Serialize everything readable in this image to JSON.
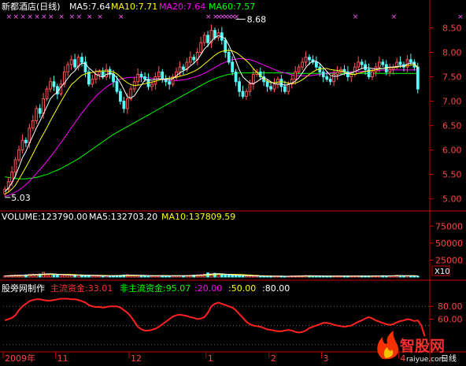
{
  "header": {
    "stock": "新都酒店(日线)",
    "ma5": "MA5:7.64",
    "ma10": "MA10:7.71",
    "ma20": "MA20:7.64",
    "ma60": "MA60:7.57"
  },
  "volume_header": {
    "volume": "VOLUME:123790.00",
    "ma5": "MA5:132703.20",
    "ma10": "MA10:137809.59",
    "multiplier": "X10"
  },
  "indicator_header": {
    "name": "股旁网制作",
    "main_fund": "主流资金:33.01",
    "non_main_fund": "非主流资金:95.07",
    "v20": ":20.00",
    "v50": ":50.00",
    "v80": ":80.00"
  },
  "x_axis": {
    "labels": [
      {
        "text": "2009年",
        "i": 0
      },
      {
        "text": "11",
        "i": 15
      },
      {
        "text": "12",
        "i": 36
      },
      {
        "text": "1",
        "i": 58
      },
      {
        "text": "2",
        "i": 76
      },
      {
        "text": "3",
        "i": 91
      },
      {
        "text": "4",
        "i": 113
      }
    ],
    "period": "日线"
  },
  "watermark": {
    "text": "智股网",
    "url": "raiyue.com"
  },
  "colors": {
    "up": "#ff5555",
    "down": "#55ffff",
    "ma5": "#ffffff",
    "ma10": "#ffff00",
    "ma20": "#ff00ff",
    "ma60": "#00ff00",
    "indicator": "#ff2020",
    "axis": "#cc0000",
    "text": "#ff4444"
  },
  "chart_data": [
    {
      "type": "candlestick",
      "title": "新都酒店(日线)",
      "ylim": [
        4.85,
        8.75
      ],
      "yticks": [
        5.0,
        5.5,
        6.0,
        6.5,
        7.0,
        7.5,
        8.0,
        8.5
      ],
      "annotations": [
        {
          "text": "8.68",
          "i": 66,
          "value": 8.68,
          "label": "high"
        },
        {
          "text": "5.03",
          "i": 0,
          "value": 5.03,
          "label": "low"
        }
      ],
      "markers": {
        "symbol": "×",
        "indices": [
          1,
          3,
          5,
          7,
          9,
          11,
          13,
          16,
          19,
          21,
          24,
          27,
          33,
          58,
          60,
          61,
          62,
          63,
          64,
          65,
          66,
          100,
          111,
          130
        ]
      },
      "close": [
        5.2,
        5.35,
        5.55,
        5.8,
        6.0,
        6.2,
        6.15,
        6.45,
        6.6,
        6.85,
        6.75,
        7.05,
        7.25,
        7.4,
        7.3,
        7.15,
        7.35,
        7.6,
        7.75,
        7.85,
        7.7,
        7.9,
        7.8,
        7.6,
        7.35,
        7.45,
        7.55,
        7.6,
        7.5,
        7.65,
        7.55,
        7.4,
        7.2,
        7.0,
        6.85,
        7.05,
        7.25,
        7.4,
        7.55,
        7.5,
        7.45,
        7.3,
        7.35,
        7.5,
        7.6,
        7.45,
        7.4,
        7.35,
        7.5,
        7.6,
        7.7,
        7.65,
        7.8,
        7.9,
        7.85,
        8.0,
        8.2,
        8.35,
        8.2,
        8.45,
        8.3,
        8.4,
        8.25,
        8.0,
        7.8,
        7.6,
        7.4,
        7.2,
        7.1,
        7.2,
        7.35,
        7.55,
        7.6,
        7.5,
        7.4,
        7.3,
        7.25,
        7.35,
        7.45,
        7.3,
        7.2,
        7.35,
        7.45,
        7.6,
        7.7,
        7.8,
        7.9,
        7.85,
        7.8,
        7.7,
        7.6,
        7.5,
        7.45,
        7.4,
        7.55,
        7.6,
        7.65,
        7.6,
        7.5,
        7.55,
        7.7,
        7.8,
        7.75,
        7.65,
        7.5,
        7.6,
        7.7,
        7.8,
        7.75,
        7.6,
        7.65,
        7.7,
        7.8,
        7.75,
        7.7,
        7.85,
        7.8,
        7.7,
        7.25
      ],
      "ma5": [
        5.15,
        5.22,
        5.33,
        5.47,
        5.65,
        5.84,
        5.97,
        6.14,
        6.29,
        6.45,
        6.59,
        6.74,
        6.89,
        7.05,
        7.13,
        7.18,
        7.29,
        7.37,
        7.47,
        7.56,
        7.62,
        7.72,
        7.78,
        7.77,
        7.68,
        7.62,
        7.55,
        7.52,
        7.49,
        7.55,
        7.57,
        7.56,
        7.48,
        7.38,
        7.24,
        7.09,
        7.07,
        7.11,
        7.22,
        7.33,
        7.43,
        7.44,
        7.43,
        7.45,
        7.46,
        7.45,
        7.46,
        7.44,
        7.46,
        7.52,
        7.58,
        7.62,
        7.66,
        7.72,
        7.78,
        7.85,
        7.95,
        8.07,
        8.14,
        8.23,
        8.3,
        8.34,
        8.32,
        8.28,
        8.15,
        7.99,
        7.83,
        7.64,
        7.5,
        7.43,
        7.37,
        7.36,
        7.4,
        7.45,
        7.48,
        7.45,
        7.4,
        7.36,
        7.35,
        7.35,
        7.33,
        7.34,
        7.37,
        7.41,
        7.48,
        7.58,
        7.69,
        7.77,
        7.82,
        7.82,
        7.77,
        7.69,
        7.61,
        7.53,
        7.51,
        7.51,
        7.54,
        7.56,
        7.57,
        7.58,
        7.61,
        7.64,
        7.67,
        7.69,
        7.68,
        7.67,
        7.66,
        7.67,
        7.67,
        7.69,
        7.7,
        7.7,
        7.71,
        7.72,
        7.72,
        7.76,
        7.78,
        7.78,
        7.66
      ],
      "ma10": [
        5.1,
        5.14,
        5.2,
        5.28,
        5.4,
        5.52,
        5.65,
        5.78,
        5.92,
        6.06,
        6.2,
        6.33,
        6.46,
        6.6,
        6.73,
        6.86,
        6.99,
        7.11,
        7.23,
        7.34,
        7.4,
        7.47,
        7.53,
        7.56,
        7.58,
        7.59,
        7.61,
        7.62,
        7.62,
        7.62,
        7.61,
        7.6,
        7.56,
        7.5,
        7.43,
        7.38,
        7.34,
        7.32,
        7.33,
        7.34,
        7.36,
        7.38,
        7.39,
        7.41,
        7.43,
        7.45,
        7.46,
        7.47,
        7.48,
        7.49,
        7.51,
        7.53,
        7.55,
        7.58,
        7.61,
        7.65,
        7.7,
        7.76,
        7.82,
        7.88,
        7.94,
        7.99,
        8.02,
        8.04,
        8.04,
        8.03,
        8.0,
        7.95,
        7.89,
        7.83,
        7.76,
        7.67,
        7.59,
        7.52,
        7.46,
        7.41,
        7.38,
        7.38,
        7.39,
        7.4,
        7.39,
        7.37,
        7.36,
        7.37,
        7.4,
        7.44,
        7.49,
        7.55,
        7.6,
        7.64,
        7.66,
        7.67,
        7.67,
        7.65,
        7.64,
        7.63,
        7.62,
        7.6,
        7.57,
        7.55,
        7.55,
        7.57,
        7.59,
        7.61,
        7.62,
        7.63,
        7.64,
        7.66,
        7.67,
        7.68,
        7.69,
        7.69,
        7.7,
        7.71,
        7.72,
        7.73,
        7.74,
        7.75,
        7.71
      ],
      "ma20": [
        5.05,
        5.07,
        5.1,
        5.14,
        5.18,
        5.23,
        5.29,
        5.36,
        5.44,
        5.52,
        5.6,
        5.68,
        5.77,
        5.86,
        5.95,
        6.05,
        6.15,
        6.25,
        6.35,
        6.46,
        6.56,
        6.66,
        6.76,
        6.85,
        6.94,
        7.02,
        7.1,
        7.17,
        7.23,
        7.29,
        7.34,
        7.38,
        7.42,
        7.45,
        7.47,
        7.48,
        7.49,
        7.49,
        7.49,
        7.49,
        7.49,
        7.48,
        7.47,
        7.46,
        7.45,
        7.44,
        7.43,
        7.42,
        7.42,
        7.42,
        7.43,
        7.44,
        7.45,
        7.47,
        7.49,
        7.51,
        7.54,
        7.57,
        7.61,
        7.65,
        7.69,
        7.73,
        7.77,
        7.8,
        7.83,
        7.85,
        7.86,
        7.87,
        7.87,
        7.86,
        7.85,
        7.83,
        7.8,
        7.77,
        7.74,
        7.71,
        7.68,
        7.65,
        7.62,
        7.6,
        7.58,
        7.56,
        7.54,
        7.53,
        7.52,
        7.52,
        7.52,
        7.52,
        7.53,
        7.54,
        7.55,
        7.56,
        7.57,
        7.58,
        7.59,
        7.6,
        7.6,
        7.6,
        7.6,
        7.6,
        7.6,
        7.61,
        7.61,
        7.62,
        7.62,
        7.63,
        7.63,
        7.63,
        7.64,
        7.64,
        7.64,
        7.64,
        7.64,
        7.64,
        7.64,
        7.64,
        7.64,
        7.64,
        7.64
      ],
      "ma60": [
        5.45,
        5.44,
        5.43,
        5.42,
        5.41,
        5.41,
        5.41,
        5.42,
        5.43,
        5.44,
        5.46,
        5.48,
        5.5,
        5.53,
        5.56,
        5.59,
        5.62,
        5.66,
        5.7,
        5.74,
        5.78,
        5.82,
        5.87,
        5.92,
        5.97,
        6.02,
        6.07,
        6.12,
        6.17,
        6.22,
        6.27,
        6.32,
        6.36,
        6.4,
        6.44,
        6.48,
        6.52,
        6.56,
        6.6,
        6.64,
        6.68,
        6.72,
        6.76,
        6.8,
        6.84,
        6.88,
        6.92,
        6.96,
        7.0,
        7.04,
        7.08,
        7.12,
        7.16,
        7.2,
        7.24,
        7.28,
        7.32,
        7.36,
        7.4,
        7.43,
        7.46,
        7.49,
        7.51,
        7.53,
        7.55,
        7.56,
        7.57,
        7.58,
        7.58,
        7.58,
        7.58,
        7.58,
        7.58,
        7.58,
        7.58,
        7.58,
        7.58,
        7.58,
        7.58,
        7.58,
        7.58,
        7.58,
        7.57,
        7.57,
        7.57,
        7.57,
        7.57,
        7.57,
        7.57,
        7.57,
        7.57,
        7.57,
        7.57,
        7.57,
        7.57,
        7.57,
        7.57,
        7.57,
        7.57,
        7.57,
        7.57,
        7.57,
        7.57,
        7.57,
        7.57,
        7.57,
        7.57,
        7.57,
        7.57,
        7.57,
        7.57,
        7.57,
        7.57,
        7.57,
        7.57,
        7.57,
        7.57,
        7.57,
        7.57
      ]
    },
    {
      "type": "bar",
      "title": "VOLUME",
      "ylim": [
        0,
        80000
      ],
      "yticks": [
        25000,
        50000,
        75000
      ],
      "volume": [
        18000,
        22000,
        25000,
        30000,
        28000,
        26000,
        32000,
        38000,
        42000,
        40000,
        44000,
        69000,
        45000,
        41000,
        38000,
        35000,
        33000,
        30000,
        28000,
        26000,
        24000,
        30000,
        27000,
        25000,
        22000,
        20000,
        19000,
        18000,
        17000,
        16000,
        18000,
        20000,
        22000,
        25000,
        30000,
        35000,
        28000,
        24000,
        22000,
        20000,
        18000,
        17000,
        16000,
        18000,
        20000,
        22000,
        20000,
        18000,
        17000,
        16000,
        18000,
        20000,
        22000,
        25000,
        28000,
        32000,
        35000,
        42000,
        60000,
        48000,
        55000,
        40000,
        35000,
        30000,
        28000,
        26000,
        24000,
        22000,
        20000,
        18000,
        17000,
        16000,
        15000,
        14000,
        13000,
        12000,
        11000,
        12000,
        13000,
        12000,
        11000,
        12000,
        14000,
        16000,
        18000,
        20000,
        22000,
        19000,
        17000,
        15000,
        14000,
        13000,
        12000,
        13000,
        14000,
        15000,
        16000,
        15000,
        14000,
        13000,
        14000,
        16000,
        18000,
        17000,
        15000,
        14000,
        16000,
        18000,
        20000,
        19000,
        18000,
        17000,
        26000,
        22000,
        18000,
        16000,
        17000,
        18000,
        12379
      ],
      "ma5": [
        17000,
        19000,
        21000,
        23000,
        25000,
        27000,
        29000,
        31000,
        34000,
        36000,
        38000,
        43000,
        46000,
        47000,
        46000,
        42000,
        38000,
        35000,
        33000,
        30000,
        28000,
        28000,
        27000,
        26000,
        25000,
        24000,
        23000,
        21000,
        19000,
        18000,
        18000,
        18000,
        19000,
        21000,
        23000,
        26000,
        28000,
        28000,
        27000,
        26000,
        24000,
        21000,
        19000,
        18000,
        18000,
        19000,
        19000,
        19000,
        19000,
        19000,
        18000,
        18000,
        19000,
        20000,
        23000,
        26000,
        28000,
        32000,
        39000,
        44000,
        48000,
        49000,
        47000,
        43000,
        38000,
        33000,
        29000,
        27000,
        24000,
        22000,
        20000,
        19000,
        17000,
        16000,
        15000,
        14000,
        13000,
        12500,
        12300,
        12000,
        12000,
        12000,
        12400,
        13000,
        14000,
        16000,
        18000,
        19000,
        19000,
        18500,
        17000,
        15500,
        14200,
        13400,
        13200,
        13500,
        14000,
        14500,
        14600,
        14600,
        14400,
        14400,
        15000,
        15600,
        16000,
        15800,
        15800,
        16200,
        17000,
        17600,
        18000,
        18000,
        20000,
        20400,
        20800,
        20600,
        19600,
        18200,
        16276
      ],
      "ma10": [
        16000,
        17000,
        18000,
        19500,
        21000,
        23000,
        25000,
        27000,
        29000,
        31000,
        33000,
        36000,
        38000,
        40000,
        41000,
        40000,
        40000,
        39000,
        39000,
        38000,
        36000,
        33000,
        31000,
        29000,
        28000,
        27000,
        26000,
        25000,
        24000,
        23000,
        22000,
        21000,
        21000,
        21000,
        21000,
        21000,
        22000,
        22000,
        22000,
        22000,
        22000,
        22000,
        21500,
        21000,
        21000,
        21000,
        21000,
        21000,
        20500,
        20000,
        20000,
        20000,
        20000,
        20500,
        21000,
        22000,
        23000,
        25000,
        28000,
        31000,
        34000,
        37000,
        39000,
        40000,
        41000,
        41000,
        40000,
        38000,
        36000,
        33000,
        30000,
        27000,
        24000,
        21000,
        19000,
        17500,
        16500,
        15500,
        14500,
        13800,
        13300,
        12800,
        12600,
        12600,
        12800,
        13300,
        14000,
        15000,
        15500,
        15700,
        15700,
        15600,
        15500,
        15300,
        15000,
        14800,
        14500,
        14300,
        14200,
        14100,
        14000,
        14200,
        14500,
        14800,
        15100,
        15300,
        15500,
        15700,
        16000,
        16300,
        16700,
        17000,
        17500,
        18000,
        18400,
        18800,
        18900,
        18900,
        17581
      ]
    },
    {
      "type": "line",
      "title": "股旁网制作",
      "series_label": "主流资金",
      "ylim": [
        10,
        100
      ],
      "yticks": [
        60,
        80
      ],
      "tick_labels": [
        "60.00",
        "80.00"
      ],
      "reference_lines": [
        20,
        50,
        80
      ],
      "main_fund": [
        58,
        60,
        62,
        66,
        74,
        80,
        84,
        88,
        90,
        91,
        91,
        90,
        89,
        89,
        90,
        91,
        92,
        92,
        92,
        91,
        91,
        90,
        88,
        86,
        82,
        80,
        79,
        79,
        78,
        79,
        80,
        80,
        80,
        78,
        74,
        70,
        64,
        56,
        48,
        44,
        42,
        42,
        43,
        45,
        48,
        52,
        56,
        60,
        64,
        66,
        67,
        66,
        65,
        63,
        62,
        60,
        61,
        63,
        70,
        80,
        84,
        86,
        84,
        82,
        80,
        78,
        74,
        68,
        62,
        56,
        52,
        50,
        49,
        48,
        46,
        44,
        43,
        42,
        41,
        41,
        42,
        43,
        42,
        40,
        39,
        40,
        42,
        46,
        48,
        50,
        52,
        54,
        54,
        53,
        51,
        50,
        49,
        48,
        49,
        50,
        53,
        56,
        58,
        61,
        63,
        61,
        58,
        56,
        54,
        52,
        51,
        52,
        55,
        57,
        58,
        60,
        59,
        57,
        58,
        50,
        33.01
      ]
    }
  ]
}
